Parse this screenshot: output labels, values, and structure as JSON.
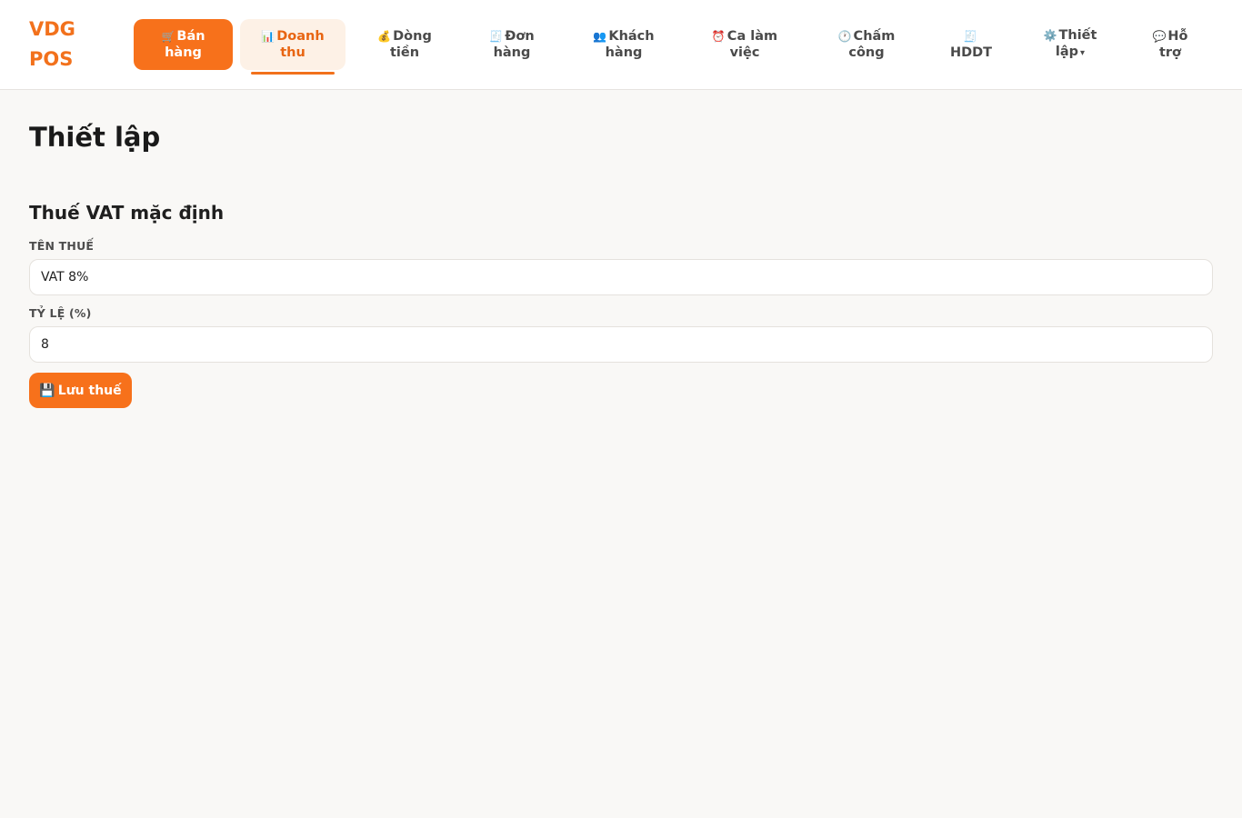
{
  "brand": {
    "line1": "VDG",
    "line2": "POS"
  },
  "nav": [
    {
      "icon": "🛒",
      "icon_name": "cart-icon",
      "line1": "Bán",
      "line2": "hàng",
      "state": "primary"
    },
    {
      "icon": "📊",
      "icon_name": "bar-chart-icon",
      "line1": "Doanh",
      "line2": "thu",
      "state": "active"
    },
    {
      "icon": "💰",
      "icon_name": "money-bag-icon",
      "line1": "Dòng",
      "line2": "tiền",
      "state": "normal"
    },
    {
      "icon": "🧾",
      "icon_name": "receipt-icon",
      "line1": "Đơn",
      "line2": "hàng",
      "state": "normal"
    },
    {
      "icon": "👥",
      "icon_name": "users-icon",
      "line1": "Khách",
      "line2": "hàng",
      "state": "normal"
    },
    {
      "icon": "⏰",
      "icon_name": "alarm-clock-icon",
      "line1": "Ca làm",
      "line2": "việc",
      "state": "normal"
    },
    {
      "icon": "🕐",
      "icon_name": "clock-icon",
      "line1": "Chấm",
      "line2": "công",
      "state": "normal"
    },
    {
      "icon": "🧾",
      "icon_name": "invoice-icon",
      "line1": "",
      "line2": "HDDT",
      "state": "normal"
    },
    {
      "icon": "⚙️",
      "icon_name": "gear-icon",
      "line1": "Thiết",
      "line2": "lập",
      "caret": "▾",
      "state": "normal"
    },
    {
      "icon": "💬",
      "icon_name": "chat-icon",
      "line1": "Hỗ",
      "line2": "trợ",
      "state": "normal"
    }
  ],
  "page": {
    "title": "Thiết lập",
    "section_title": "Thuế VAT mặc định",
    "tax_name_label": "TÊN THUẾ",
    "tax_name_value": "VAT 8%",
    "tax_rate_label": "TỶ LỆ (%)",
    "tax_rate_value": "8",
    "save_icon": "💾",
    "save_label": "Lưu thuế"
  },
  "colors": {
    "accent": "#f7711b",
    "active_bg": "#fdf1e6",
    "page_bg": "#f9f8f6"
  }
}
